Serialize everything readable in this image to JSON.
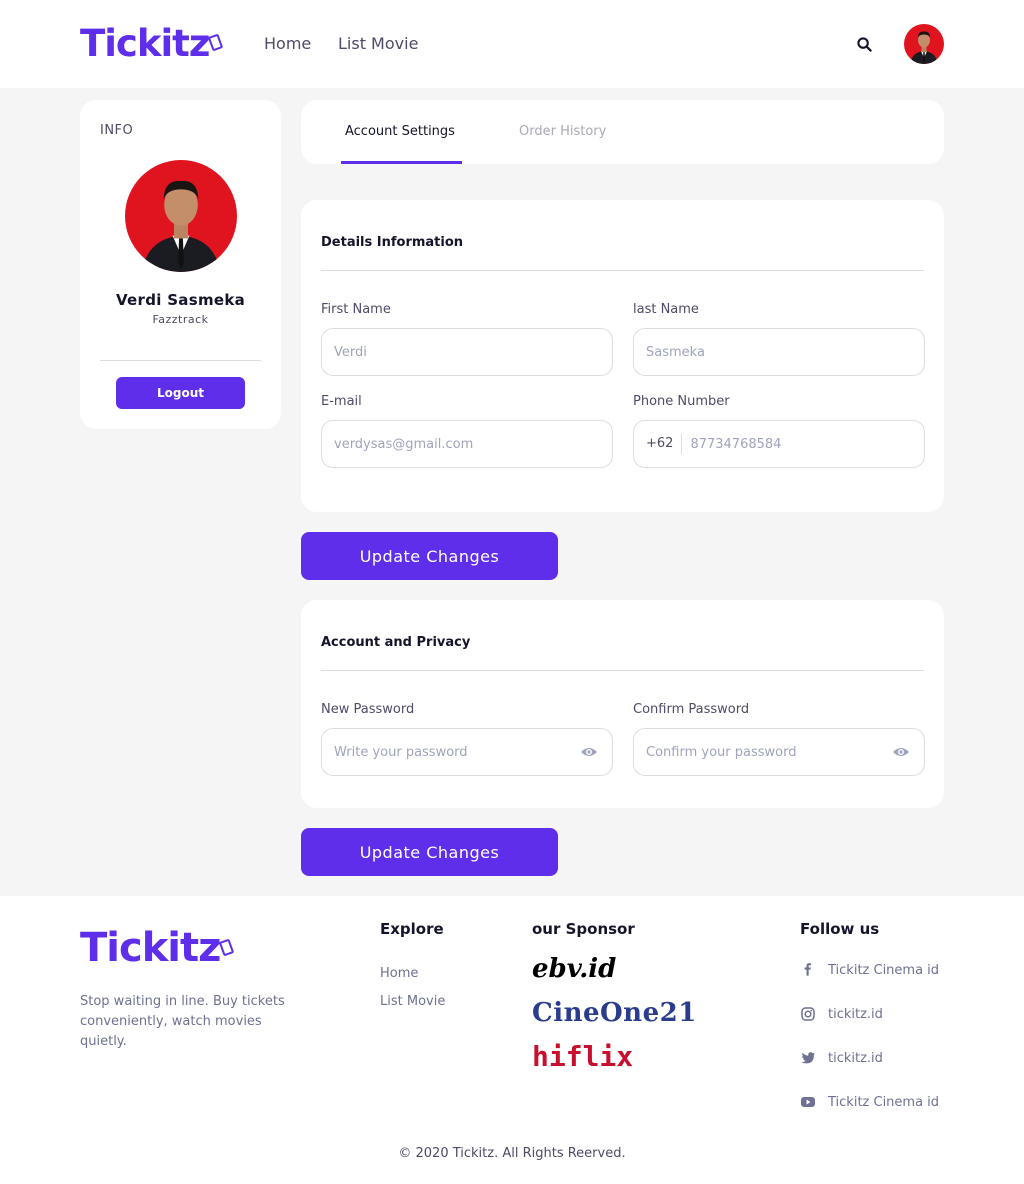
{
  "header": {
    "logo": "Tickitz",
    "nav": [
      "Home",
      "List Movie"
    ]
  },
  "info": {
    "label": "INFO",
    "name": "Verdi Sasmeka",
    "subtitle": "Fazztrack",
    "logout": "Logout"
  },
  "tabs": {
    "active": "Account Settings",
    "inactive": "Order History"
  },
  "details": {
    "title": "Details Information",
    "first_name_label": "First Name",
    "first_name_value": "Verdi",
    "last_name_label": "last Name",
    "last_name_value": "Sasmeka",
    "email_label": "E-mail",
    "email_value": "verdysas@gmail.com",
    "phone_label": "Phone Number",
    "phone_prefix": "+62",
    "phone_value": "87734768584"
  },
  "privacy": {
    "title": "Account and Privacy",
    "new_password_label": "New Password",
    "new_password_placeholder": "Write your password",
    "confirm_password_label": "Confirm Password",
    "confirm_password_placeholder": "Confirm your password"
  },
  "update_button": "Update Changes",
  "footer": {
    "logo": "Tickitz",
    "tagline": "Stop waiting in line. Buy tickets conveniently, watch movies quietly.",
    "explore_title": "Explore",
    "explore_links": [
      "Home",
      "List Movie"
    ],
    "sponsor_title": "our Sponsor",
    "sponsors": [
      "ebv.id",
      "CineOne21",
      "hiflix"
    ],
    "follow_title": "Follow us",
    "follow": [
      {
        "icon": "facebook-icon",
        "text": "Tickitz Cinema id"
      },
      {
        "icon": "instagram-icon",
        "text": "tickitz.id"
      },
      {
        "icon": "twitter-icon",
        "text": "tickitz.id"
      },
      {
        "icon": "youtube-icon",
        "text": "Tickitz Cinema id"
      }
    ],
    "copyright": "© 2020 Tickitz. All Rights Reerved."
  },
  "colors": {
    "primary": "#5F2EEA",
    "background": "#F5F5F5",
    "card": "#FFFFFF"
  }
}
